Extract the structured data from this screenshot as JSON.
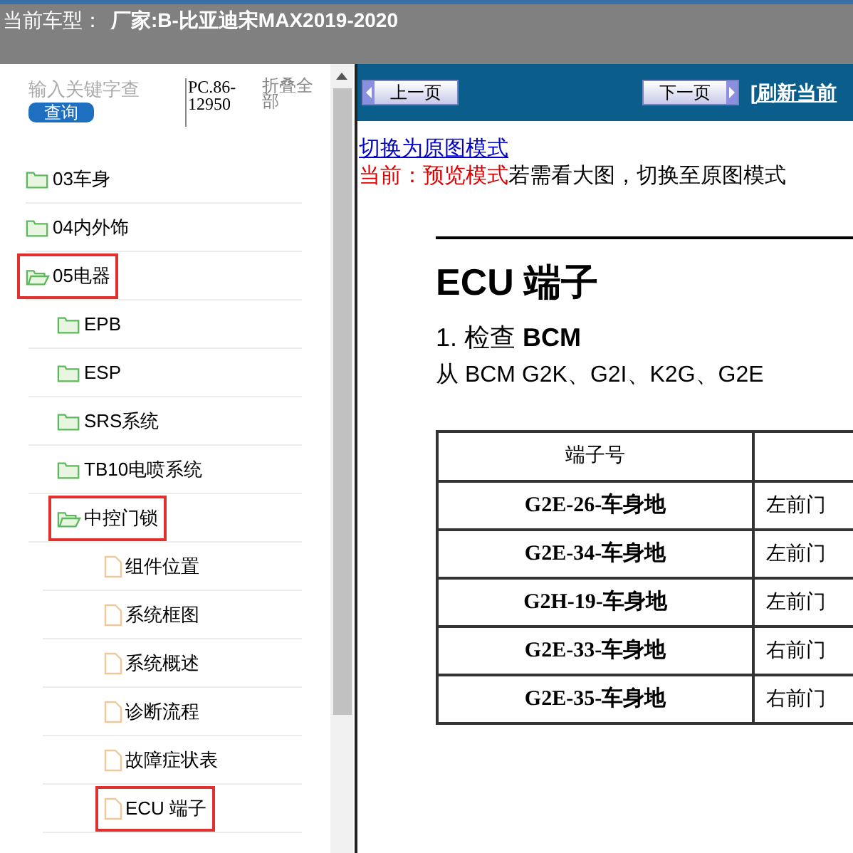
{
  "header": {
    "label": "当前车型：",
    "vehicle": "厂家:B-比亚迪宋MAX2019-2020"
  },
  "sidebar": {
    "search": {
      "placeholder": "输入关键字查"
    },
    "search_button": "查询",
    "code": "PC.86-12950",
    "collapse_all": "折叠全部",
    "tree": [
      {
        "label": "03车身",
        "kind": "folder",
        "expanded": false,
        "highlighted": false
      },
      {
        "label": "04内外饰",
        "kind": "folder",
        "expanded": false,
        "highlighted": false
      },
      {
        "label": "05电器",
        "kind": "folder",
        "expanded": true,
        "highlighted": true,
        "children": [
          {
            "label": "EPB",
            "kind": "folder",
            "expanded": false,
            "highlighted": false
          },
          {
            "label": "ESP",
            "kind": "folder",
            "expanded": false,
            "highlighted": false
          },
          {
            "label": "SRS系统",
            "kind": "folder",
            "expanded": false,
            "highlighted": false
          },
          {
            "label": "TB10电喷系统",
            "kind": "folder",
            "expanded": false,
            "highlighted": false
          },
          {
            "label": "中控门锁",
            "kind": "folder",
            "expanded": true,
            "highlighted": true,
            "children": [
              {
                "label": "组件位置",
                "kind": "page",
                "highlighted": false
              },
              {
                "label": "系统框图",
                "kind": "page",
                "highlighted": false
              },
              {
                "label": "系统概述",
                "kind": "page",
                "highlighted": false
              },
              {
                "label": "诊断流程",
                "kind": "page",
                "highlighted": false
              },
              {
                "label": "故障症状表",
                "kind": "page",
                "highlighted": false
              },
              {
                "label": "ECU 端子",
                "kind": "page",
                "highlighted": true
              }
            ]
          }
        ]
      }
    ]
  },
  "toolbar": {
    "prev": "上一页",
    "next": "下一页",
    "refresh": "[刷新当前"
  },
  "mode": {
    "switch_link": "切换为原图模式",
    "current_label": "当前：预览模式",
    "hint": "若需看大图，切换至原图模式"
  },
  "document": {
    "title": "ECU 端子",
    "step": "1. 检查 **BCM**",
    "text": "从 BCM G2K、G2I、K2G、G2E",
    "table": {
      "columns": [
        "端子号"
      ],
      "rows": [
        [
          "G2E-26-车身地",
          "左前门"
        ],
        [
          "G2E-34-车身地",
          "左前门"
        ],
        [
          "G2H-19-车身地",
          "左前门"
        ],
        [
          "G2E-33-车身地",
          "右前门"
        ],
        [
          "G2E-35-车身地",
          "右前门"
        ]
      ]
    }
  }
}
